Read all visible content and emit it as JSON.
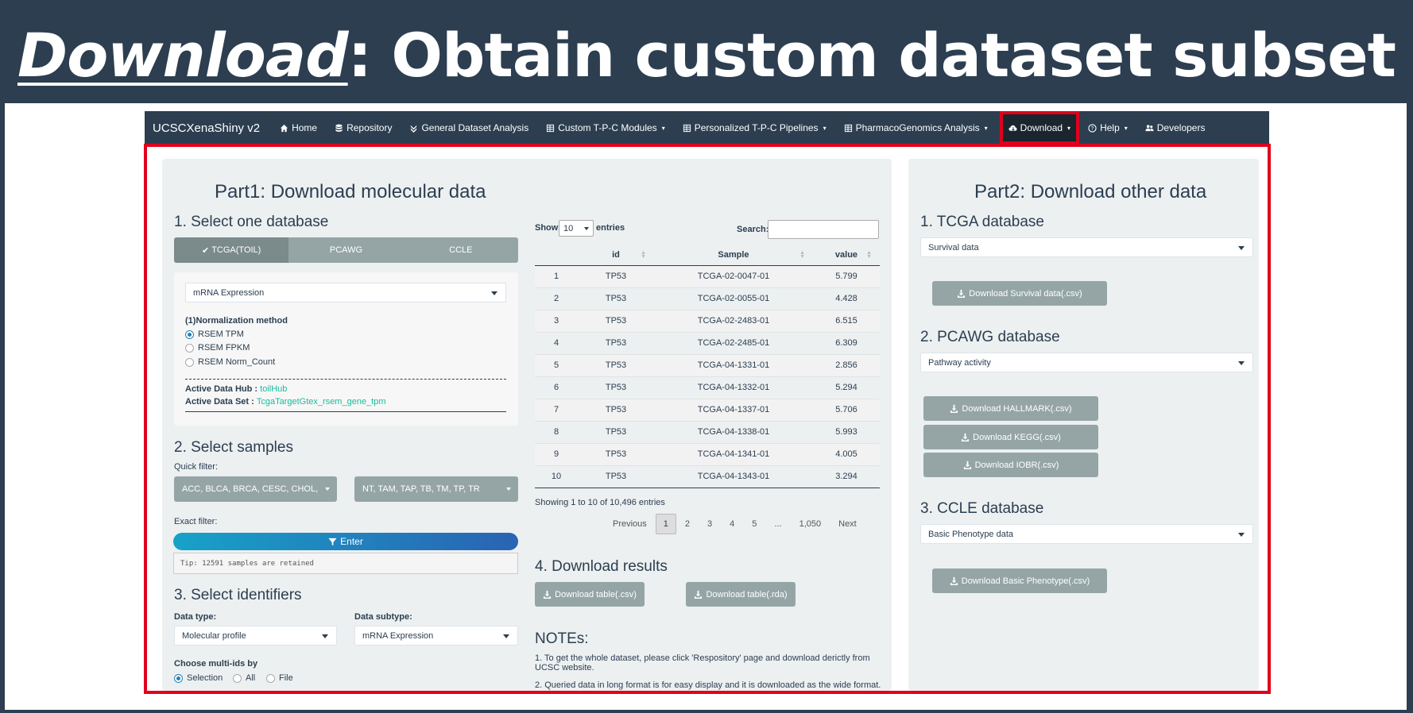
{
  "slide": {
    "title_keyword": "Download",
    "title_rest": ": Obtain custom dataset subset"
  },
  "navbar": {
    "brand": "UCSCXenaShiny v2",
    "items": [
      {
        "label": "Home"
      },
      {
        "label": "Repository"
      },
      {
        "label": "General Dataset Analysis"
      },
      {
        "label": "Custom T-P-C Modules"
      },
      {
        "label": "Personalized T-P-C Pipelines"
      },
      {
        "label": "PharmacoGenomics Analysis"
      },
      {
        "label": "Download"
      },
      {
        "label": "Help"
      },
      {
        "label": "Developers"
      }
    ]
  },
  "part1": {
    "title": "Part1: Download molecular data",
    "step1": {
      "title": "1. Select one database",
      "tabs": [
        "TCGA(TOIL)",
        "PCAWG",
        "CCLE"
      ],
      "selected_tab": "TCGA(TOIL)",
      "profile_select": "mRNA Expression",
      "norm_label": "(1)Normalization method",
      "norm_options": [
        "RSEM TPM",
        "RSEM FPKM",
        "RSEM Norm_Count"
      ],
      "norm_selected": "RSEM TPM",
      "hub_label": "Active Data Hub :",
      "hub_value": "toilHub",
      "set_label": "Active Data Set :",
      "set_value": "TcgaTargetGtex_rsem_gene_tpm"
    },
    "step2": {
      "title": "2. Select samples",
      "quick_filter_label": "Quick filter:",
      "cancer_filter": "ACC, BLCA, BRCA, CESC, CHOL, COAD",
      "type_filter": "NT, TAM, TAP, TB, TM, TP, TR",
      "exact_filter_label": "Exact filter:",
      "enter_label": "Enter",
      "tip": "Tip: 12591 samples are retained"
    },
    "step3": {
      "title": "3. Select identifiers",
      "data_type_label": "Data type:",
      "data_type": "Molecular profile",
      "data_subtype_label": "Data subtype:",
      "data_subtype": "mRNA Expression",
      "multi_ids_label": "Choose multi-ids by",
      "multi_ids_options": [
        "Selection",
        "All",
        "File"
      ],
      "multi_ids_selected": "Selection"
    },
    "table": {
      "show_label": "Show",
      "page_length": "10",
      "entries_label": "entries",
      "search_label": "Search:",
      "columns": [
        "",
        "id",
        "Sample",
        "value"
      ],
      "rows": [
        [
          "1",
          "TP53",
          "TCGA-02-0047-01",
          "5.799"
        ],
        [
          "2",
          "TP53",
          "TCGA-02-0055-01",
          "4.428"
        ],
        [
          "3",
          "TP53",
          "TCGA-02-2483-01",
          "6.515"
        ],
        [
          "4",
          "TP53",
          "TCGA-02-2485-01",
          "6.309"
        ],
        [
          "5",
          "TP53",
          "TCGA-04-1331-01",
          "2.856"
        ],
        [
          "6",
          "TP53",
          "TCGA-04-1332-01",
          "5.294"
        ],
        [
          "7",
          "TP53",
          "TCGA-04-1337-01",
          "5.706"
        ],
        [
          "8",
          "TP53",
          "TCGA-04-1338-01",
          "5.993"
        ],
        [
          "9",
          "TP53",
          "TCGA-04-1341-01",
          "4.005"
        ],
        [
          "10",
          "TP53",
          "TCGA-04-1343-01",
          "3.294"
        ]
      ],
      "info": "Showing 1 to 10 of 10,496 entries",
      "pager": [
        "Previous",
        "1",
        "2",
        "3",
        "4",
        "5",
        "...",
        "1,050",
        "Next"
      ]
    },
    "step4": {
      "title": "4. Download results",
      "csv_button": "Download table(.csv)",
      "rda_button": "Download table(.rda)"
    },
    "notes": {
      "title": "NOTEs:",
      "items": [
        "1. To get the whole dataset, please click 'Respository' page and download derictly from UCSC website.",
        "2. Queried data in long format is for easy display and it is downloaded as the wide format."
      ]
    }
  },
  "part2": {
    "title": "Part2: Download other data",
    "tcga": {
      "title": "1. TCGA database",
      "select": "Survival data",
      "button": "Download Survival data(.csv)"
    },
    "pcawg": {
      "title": "2. PCAWG database",
      "select": "Pathway activity",
      "buttons": [
        "Download HALLMARK(.csv)",
        "Download KEGG(.csv)",
        "Download IOBR(.csv)"
      ]
    },
    "ccle": {
      "title": "3. CCLE database",
      "select": "Basic Phenotype data",
      "button": "Download Basic Phenotype(.csv)"
    }
  },
  "colors": {
    "navbar": "#2c3e50",
    "highlight": "#e0001b",
    "panel": "#ecf0f1",
    "button": "#95a5a6",
    "link": "#18bc9c"
  }
}
